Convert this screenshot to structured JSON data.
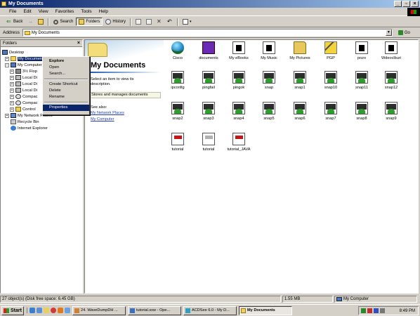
{
  "window": {
    "title": "My Documents"
  },
  "menubar": {
    "items": [
      "File",
      "Edit",
      "View",
      "Favorites",
      "Tools",
      "Help"
    ]
  },
  "toolbar": {
    "back": "Back",
    "search": "Search",
    "folders": "Folders",
    "history": "History"
  },
  "addressbar": {
    "label": "Address",
    "value": "My Documents",
    "go": "Go"
  },
  "folders_pane": {
    "title": "Folders",
    "tree": [
      "Desktop",
      "My Documents",
      "My Computer",
      "3½ Flop",
      "Local Di",
      "Local Di",
      "Local Di",
      "Compac",
      "Compac",
      "Control",
      "My Network Places",
      "Recycle Bin",
      "Internet Explorer"
    ]
  },
  "context_menu": {
    "items": [
      "Explore",
      "Open",
      "Search...",
      "Create Shortcut",
      "Delete",
      "Rename",
      "Properties"
    ]
  },
  "webview": {
    "title": "My Documents",
    "desc": "Select an item to view its description.",
    "tip": "Stores and manages documents",
    "see_also": "See also:",
    "links": [
      "My Network Places",
      "My Computer"
    ]
  },
  "files": [
    {
      "name": "Cisco",
      "icon": "globe-icon"
    },
    {
      "name": "documents",
      "icon": "app-icon"
    },
    {
      "name": "My eBooks",
      "icon": "doc-icon"
    },
    {
      "name": "My Music",
      "icon": "doc-icon"
    },
    {
      "name": "My Pictures",
      "icon": "folder-pictures-icon"
    },
    {
      "name": "PGP",
      "icon": "key-icon"
    },
    {
      "name": "pozo",
      "icon": "doc-icon"
    },
    {
      "name": "Wdeoclburi",
      "icon": "doc-icon"
    },
    {
      "name": "ipconfig",
      "icon": "image-icon"
    },
    {
      "name": "pingfail",
      "icon": "image-icon"
    },
    {
      "name": "pingok",
      "icon": "image-icon"
    },
    {
      "name": "snap",
      "icon": "image-icon"
    },
    {
      "name": "snap1",
      "icon": "image-icon"
    },
    {
      "name": "snap10",
      "icon": "image-icon"
    },
    {
      "name": "snap11",
      "icon": "image-icon"
    },
    {
      "name": "snap12",
      "icon": "image-icon"
    },
    {
      "name": "snap2",
      "icon": "image-icon"
    },
    {
      "name": "snap3",
      "icon": "image-icon"
    },
    {
      "name": "snap4",
      "icon": "image-icon"
    },
    {
      "name": "snap5",
      "icon": "image-icon"
    },
    {
      "name": "snap6",
      "icon": "image-icon"
    },
    {
      "name": "snap7",
      "icon": "image-icon"
    },
    {
      "name": "snap8",
      "icon": "image-icon"
    },
    {
      "name": "snap9",
      "icon": "image-icon"
    },
    {
      "name": "tutorial",
      "icon": "pdf-icon"
    },
    {
      "name": "tutorial",
      "icon": "pdf-gray-icon"
    },
    {
      "name": "tutorial_JAVA",
      "icon": "pdf-icon"
    }
  ],
  "statusbar": {
    "objects": "27 object(s) (Disk free space: 6.45 GB)",
    "size": "1.55 MB",
    "location": "My Computer"
  },
  "taskbar": {
    "start": "Start",
    "tasks": [
      "24. WaveDumpDH ...",
      "tutorial.sxw - Ope...",
      "ACDSee 6.0 - My D...",
      "My Documents"
    ],
    "clock": "8:49 PM"
  }
}
